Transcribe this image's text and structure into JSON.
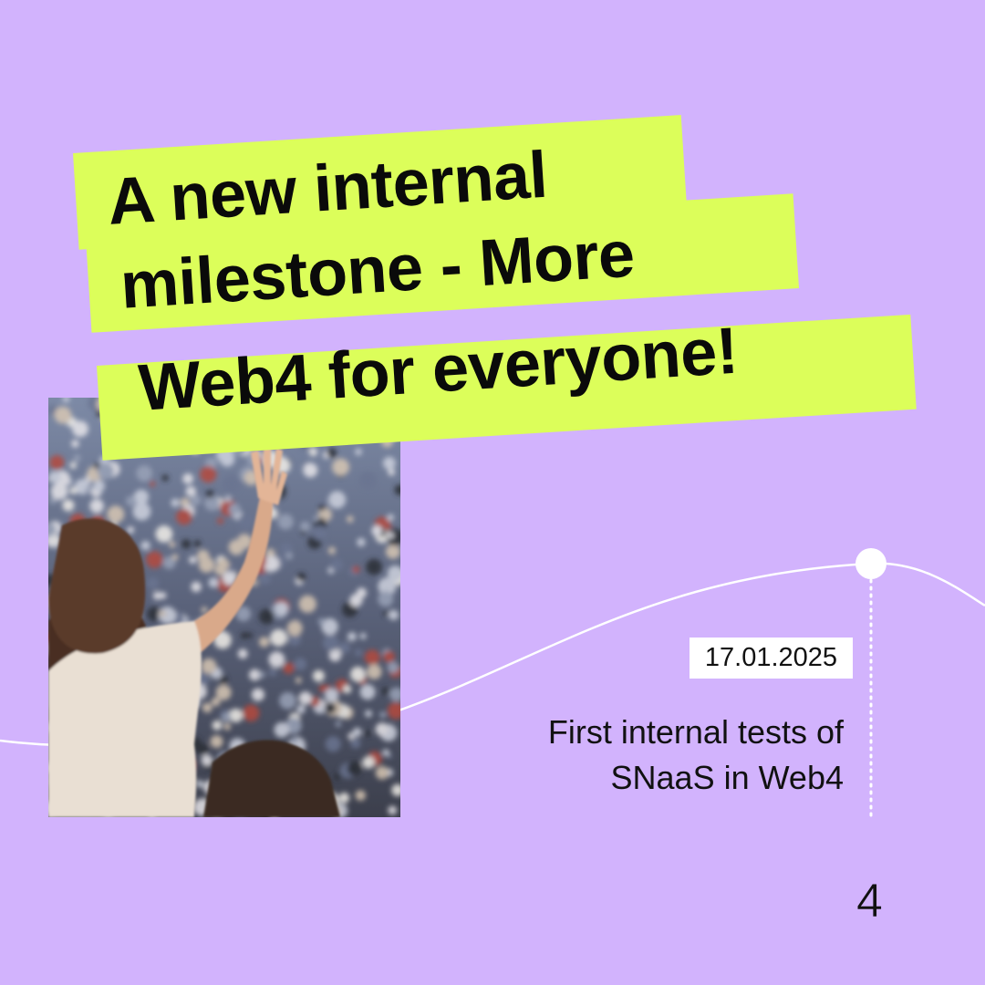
{
  "headline": {
    "lines": [
      "A new internal",
      "milestone - More",
      "Web4 for everyone!"
    ]
  },
  "timeline": {
    "date": "17.01.2025",
    "description_lines": [
      "First internal tests of",
      "SNaaS in Web4"
    ]
  },
  "page_number": "4",
  "photo": {
    "subject": "crowd-with-raised-hand-photo"
  },
  "colors": {
    "background": "#d2b3fd",
    "highlight": "#dcfe5a",
    "text": "#0a0a0a",
    "wave": "#ffffff"
  }
}
